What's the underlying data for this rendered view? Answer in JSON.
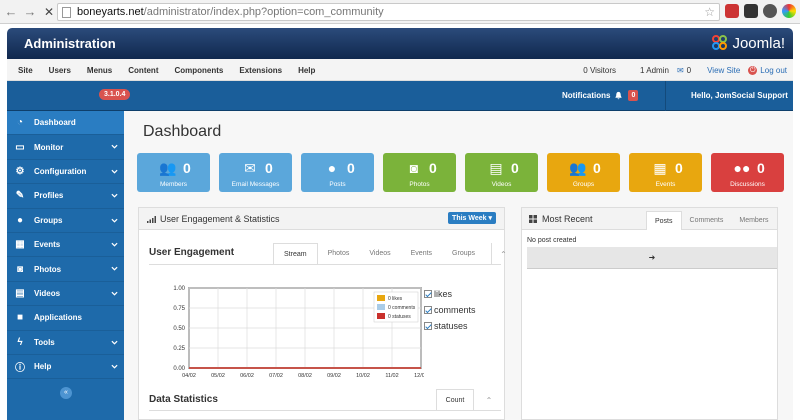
{
  "browser": {
    "url_host": "boneyarts.net",
    "url_path": "/administrator/index.php?option=com_community"
  },
  "header": {
    "title": "Administration",
    "brand": "Joomla!"
  },
  "menu": {
    "items": [
      "Site",
      "Users",
      "Menus",
      "Content",
      "Components",
      "Extensions",
      "Help"
    ],
    "visitors": "0 Visitors",
    "admins": "1 Admin",
    "messages": "0",
    "view_site": "View Site",
    "logout": "Log out"
  },
  "subheader": {
    "version": "3.1.0.4",
    "notifications_label": "Notifications",
    "notifications_count": "0",
    "greeting": "Hello, JomSocial Support"
  },
  "sidebar": {
    "items": [
      {
        "label": "Dashboard",
        "icon": "dashboard-icon"
      },
      {
        "label": "Monitor",
        "icon": "monitor-icon"
      },
      {
        "label": "Configuration",
        "icon": "cogs-icon"
      },
      {
        "label": "Profiles",
        "icon": "edit-icon"
      },
      {
        "label": "Groups",
        "icon": "groups-icon"
      },
      {
        "label": "Events",
        "icon": "calendar-icon"
      },
      {
        "label": "Photos",
        "icon": "camera-icon"
      },
      {
        "label": "Videos",
        "icon": "film-icon"
      },
      {
        "label": "Applications",
        "icon": "briefcase-icon"
      },
      {
        "label": "Tools",
        "icon": "bolt-icon"
      },
      {
        "label": "Help",
        "icon": "info-icon"
      }
    ],
    "collapse": "«"
  },
  "dashboard": {
    "title": "Dashboard",
    "tiles": [
      {
        "label": "Members",
        "count": "0",
        "color": "#5ba7db",
        "icon": "users-icon"
      },
      {
        "label": "Email Messages",
        "count": "0",
        "color": "#5ba7db",
        "icon": "envelope-icon"
      },
      {
        "label": "Posts",
        "count": "0",
        "color": "#5ba7db",
        "icon": "comment-icon"
      },
      {
        "label": "Photos",
        "count": "0",
        "color": "#7bb33a",
        "icon": "camera-icon"
      },
      {
        "label": "Videos",
        "count": "0",
        "color": "#7bb33a",
        "icon": "film-icon"
      },
      {
        "label": "Groups",
        "count": "0",
        "color": "#e8a70f",
        "icon": "groups-icon"
      },
      {
        "label": "Events",
        "count": "0",
        "color": "#e8a70f",
        "icon": "calendar-icon"
      },
      {
        "label": "Discussions",
        "count": "0",
        "color": "#d9403f",
        "icon": "discussion-icon"
      }
    ]
  },
  "engagement": {
    "panel_title": "User Engagement & Statistics",
    "week_button": "This Week ▾",
    "section_title": "User Engagement",
    "tabs": [
      "Stream",
      "Photos",
      "Videos",
      "Events",
      "Groups"
    ],
    "collapse": "⌃",
    "checkboxes": [
      "likes",
      "comments",
      "statuses"
    ],
    "data_stats_title": "Data Statistics",
    "count_tab": "Count"
  },
  "chart_data": {
    "type": "line",
    "categories": [
      "04/02",
      "05/02",
      "06/02",
      "07/02",
      "08/02",
      "09/02",
      "10/02",
      "11/02",
      "12/02"
    ],
    "y_ticks": [
      "1.00",
      "0.75",
      "0.50",
      "0.25",
      "0.00"
    ],
    "ylim": [
      0,
      1
    ],
    "grid": true,
    "legend_position": "top-right",
    "series": [
      {
        "name": "0 likes",
        "color": "#e8a70f",
        "values": [
          0,
          0,
          0,
          0,
          0,
          0,
          0,
          0,
          0
        ]
      },
      {
        "name": "0 comments",
        "color": "#a9cce8",
        "values": [
          0,
          0,
          0,
          0,
          0,
          0,
          0,
          0,
          0
        ]
      },
      {
        "name": "0 statuses",
        "color": "#c9302c",
        "values": [
          0,
          0,
          0,
          0,
          0,
          0,
          0,
          0,
          0
        ]
      }
    ]
  },
  "recent": {
    "title": "Most Recent",
    "tabs": [
      "Posts",
      "Comments",
      "Members"
    ],
    "empty_text": "No post created",
    "more_arrow": "➜"
  }
}
